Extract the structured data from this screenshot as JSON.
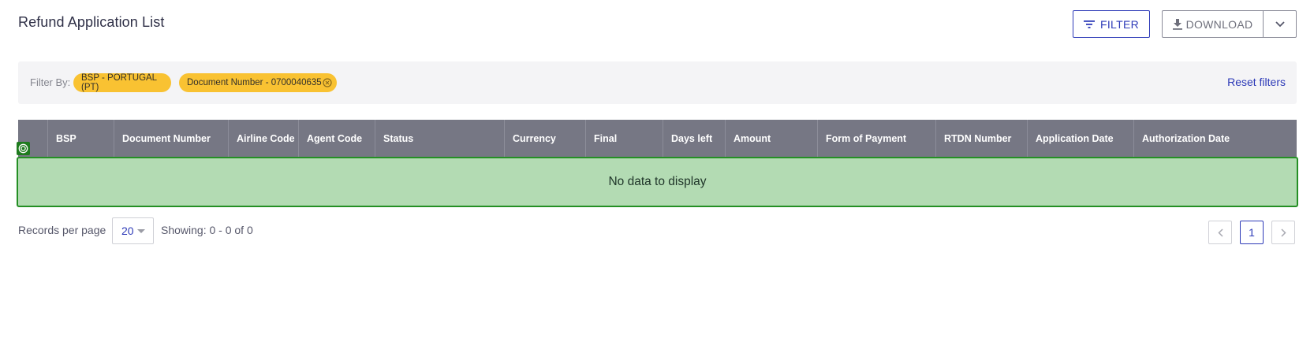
{
  "page": {
    "title": "Refund Application List"
  },
  "toolbar": {
    "filter_label": "FILTER",
    "download_label": "DOWNLOAD",
    "filter_icon": "filter-lines-icon",
    "download_icon": "download-icon",
    "caret_icon": "chevron-down-icon"
  },
  "filters": {
    "label": "Filter By:",
    "chips": [
      {
        "text": "BSP - PORTUGAL (PT)",
        "removable": false
      },
      {
        "text": "Document Number - 0700040635",
        "removable": true
      }
    ],
    "reset_label": "Reset filters"
  },
  "table": {
    "columns": [
      "",
      "BSP",
      "Document Number",
      "Airline Code",
      "Agent Code",
      "Status",
      "Currency",
      "Final",
      "Days left",
      "Amount",
      "Form of Payment",
      "RTDN Number",
      "Application Date",
      "Authorization Date"
    ],
    "empty_message": "No data to display"
  },
  "pagination": {
    "records_label": "Records per page",
    "per_page": "20",
    "showing": "Showing: 0 - 0 of 0",
    "current_page": "1"
  },
  "colors": {
    "primary": "#2e3bb8",
    "chip": "#f9c232",
    "header_bg": "#767784",
    "empty_bg": "#b3dbb3",
    "empty_border": "#248f24"
  }
}
